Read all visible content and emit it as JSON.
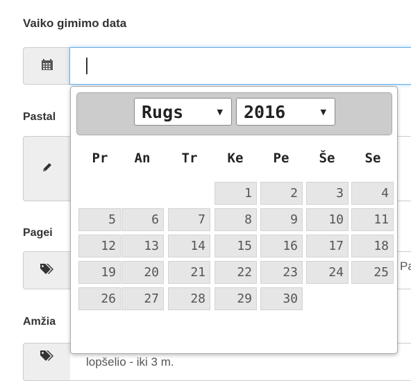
{
  "form": {
    "birthdate_label": "Vaiko gimimo data",
    "birthdate_value": "",
    "pastaba_label": "Pastal",
    "pageid_label": "Pagei",
    "pageid_overflow_text": "Pa",
    "age_label": "Amžia",
    "age_value_text": "lopšelio - iki 3 m."
  },
  "calendar": {
    "month": "Rugs",
    "year": "2016",
    "weekdays": [
      "Pr",
      "An",
      "Tr",
      "Ke",
      "Pe",
      "Še",
      "Se"
    ],
    "weeks": [
      [
        "",
        "",
        "",
        "1",
        "2",
        "3",
        "4"
      ],
      [
        "5",
        "6",
        "7",
        "8",
        "9",
        "10",
        "11"
      ],
      [
        "12",
        "13",
        "14",
        "15",
        "16",
        "17",
        "18"
      ],
      [
        "19",
        "20",
        "21",
        "22",
        "23",
        "24",
        "25"
      ],
      [
        "26",
        "27",
        "28",
        "29",
        "30",
        "",
        ""
      ]
    ]
  },
  "icons": {
    "calendar": "calendar-icon",
    "pencil": "pencil-icon",
    "tags": "tags-icon"
  }
}
